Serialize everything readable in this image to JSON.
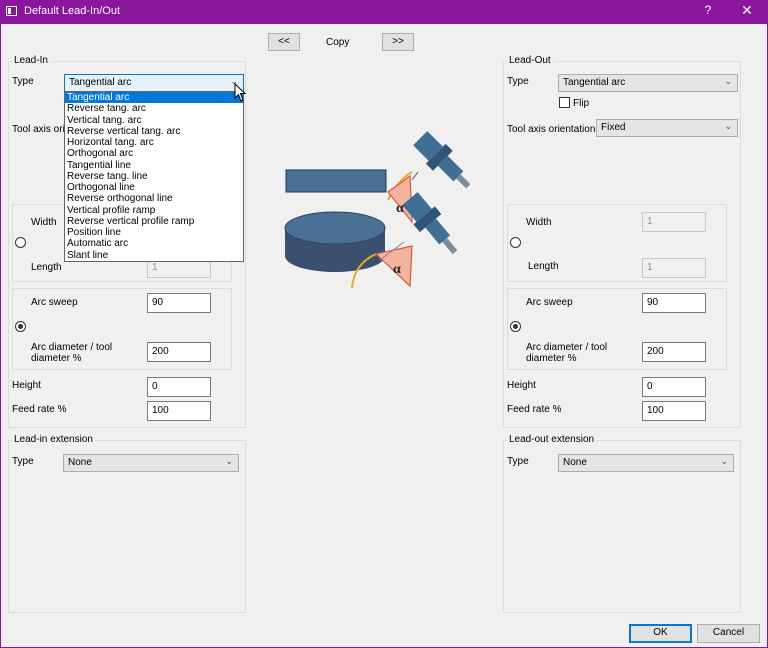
{
  "window": {
    "title": "Default Lead-In/Out",
    "help_label": "?",
    "close_label": "✕"
  },
  "copy_bar": {
    "prev_label": "<<",
    "copy_label": "Copy",
    "next_label": ">>"
  },
  "lead_in": {
    "title": "Lead-In",
    "type_label": "Type",
    "type_value": "Tangential arc",
    "tool_axis_label": "Tool axis ori",
    "width_label": "Width",
    "length_label": "Length",
    "length_value": "1",
    "arc_sweep_label": "Arc sweep",
    "arc_sweep_value": "90",
    "arc_diameter_label_1": "Arc diameter / tool",
    "arc_diameter_label_2": "diameter %",
    "arc_diameter_value": "200",
    "height_label": "Height",
    "height_value": "0",
    "feed_rate_label": "Feed rate %",
    "feed_rate_value": "100",
    "dropdown_options": [
      "Tangential arc",
      "Reverse tang. arc",
      "Vertical tang. arc",
      "Reverse vertical tang. arc",
      "Horizontal tang. arc",
      "Orthogonal arc",
      "Tangential line",
      "Reverse tang. line",
      "Orthogonal line",
      "Reverse orthogonal line",
      "Vertical profile ramp",
      "Reverse vertical profile ramp",
      "Position line",
      "Automatic arc",
      "Slant line"
    ]
  },
  "lead_out": {
    "title": "Lead-Out",
    "type_label": "Type",
    "type_value": "Tangential arc",
    "flip_label": "Flip",
    "tool_axis_label": "Tool axis orientation",
    "tool_axis_value": "Fixed",
    "width_label": "Width",
    "width_value": "1",
    "length_label": "Length",
    "length_value": "1",
    "arc_sweep_label": "Arc sweep",
    "arc_sweep_value": "90",
    "arc_diameter_label_1": "Arc diameter / tool",
    "arc_diameter_label_2": "diameter %",
    "arc_diameter_value": "200",
    "height_label": "Height",
    "height_value": "0",
    "feed_rate_label": "Feed rate %",
    "feed_rate_value": "100"
  },
  "lead_in_extension": {
    "title": "Lead-in extension",
    "type_label": "Type",
    "type_value": "None"
  },
  "lead_out_extension": {
    "title": "Lead-out extension",
    "type_label": "Type",
    "type_value": "None"
  },
  "diagram": {
    "alpha_symbol": "α"
  },
  "footer": {
    "ok_label": "OK",
    "cancel_label": "Cancel"
  },
  "colors": {
    "titlebar": "#8a169e",
    "selection": "#0078d7",
    "tool_body": "#3f6f92",
    "alpha_fill": "#f4b39f",
    "arc_line": "#f0a81e"
  }
}
